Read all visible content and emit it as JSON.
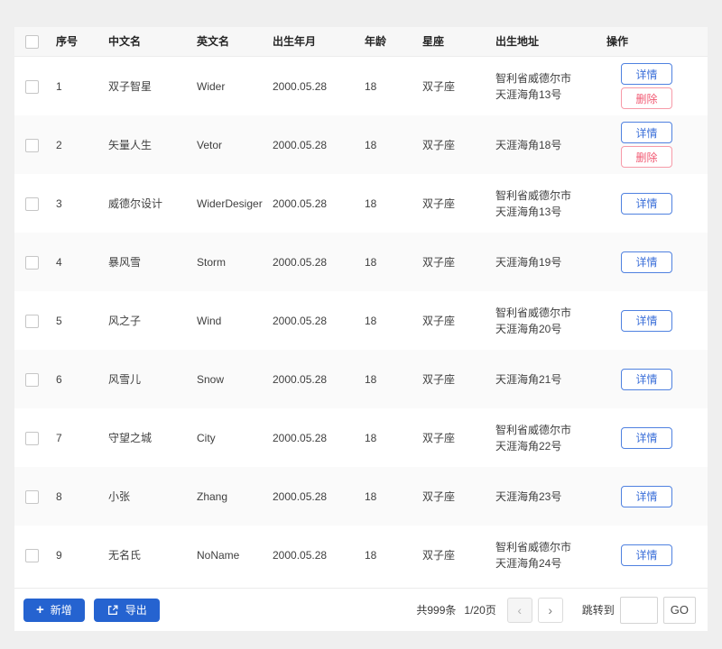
{
  "colors": {
    "accent_blue": "#2563d0",
    "detail_blue": "#3b6fd9",
    "delete_red": "#f15a73",
    "header_bg": "#f7f7f7",
    "stripe_bg": "#fafafa",
    "outer_bg": "#efefef"
  },
  "table": {
    "columns": [
      {
        "key": "index",
        "label": "序号"
      },
      {
        "key": "cn",
        "label": "中文名"
      },
      {
        "key": "en",
        "label": "英文名"
      },
      {
        "key": "birth",
        "label": "出生年月"
      },
      {
        "key": "age",
        "label": "年龄"
      },
      {
        "key": "zodiac",
        "label": "星座"
      },
      {
        "key": "address",
        "label": "出生地址"
      },
      {
        "key": "actions",
        "label": "操作"
      }
    ],
    "action_labels": {
      "detail": "详情",
      "delete": "删除"
    },
    "rows": [
      {
        "index": "1",
        "cn": "双子智星",
        "en": "Wider",
        "birth": "2000.05.28",
        "age": "18",
        "zodiac": "双子座",
        "address": "智利省威德尔市\n天涯海角13号",
        "actions": [
          "detail",
          "delete"
        ]
      },
      {
        "index": "2",
        "cn": "矢量人生",
        "en": "Vetor",
        "birth": "2000.05.28",
        "age": "18",
        "zodiac": "双子座",
        "address": "天涯海角18号",
        "actions": [
          "detail",
          "delete"
        ]
      },
      {
        "index": "3",
        "cn": "威德尔设计",
        "en": "WiderDesiger",
        "birth": "2000.05.28",
        "age": "18",
        "zodiac": "双子座",
        "address": "智利省威德尔市\n天涯海角13号",
        "actions": [
          "detail"
        ]
      },
      {
        "index": "4",
        "cn": "暴风雪",
        "en": "Storm",
        "birth": "2000.05.28",
        "age": "18",
        "zodiac": "双子座",
        "address": "天涯海角19号",
        "actions": [
          "detail"
        ]
      },
      {
        "index": "5",
        "cn": "风之子",
        "en": "Wind",
        "birth": "2000.05.28",
        "age": "18",
        "zodiac": "双子座",
        "address": "智利省威德尔市\n天涯海角20号",
        "actions": [
          "detail"
        ]
      },
      {
        "index": "6",
        "cn": "风雪儿",
        "en": "Snow",
        "birth": "2000.05.28",
        "age": "18",
        "zodiac": "双子座",
        "address": "天涯海角21号",
        "actions": [
          "detail"
        ]
      },
      {
        "index": "7",
        "cn": "守望之城",
        "en": "City",
        "birth": "2000.05.28",
        "age": "18",
        "zodiac": "双子座",
        "address": "智利省威德尔市\n天涯海角22号",
        "actions": [
          "detail"
        ]
      },
      {
        "index": "8",
        "cn": "小张",
        "en": "Zhang",
        "birth": "2000.05.28",
        "age": "18",
        "zodiac": "双子座",
        "address": "天涯海角23号",
        "actions": [
          "detail"
        ]
      },
      {
        "index": "9",
        "cn": "无名氏",
        "en": "NoName",
        "birth": "2000.05.28",
        "age": "18",
        "zodiac": "双子座",
        "address": "智利省威德尔市\n天涯海角24号",
        "actions": [
          "detail"
        ]
      }
    ]
  },
  "footer": {
    "add_label": "新增",
    "export_label": "导出",
    "total_text": "共999条",
    "page_text": "1/20页",
    "prev_icon": "‹",
    "next_icon": "›",
    "jump_label": "跳转到",
    "jump_value": "",
    "go_label": "GO"
  }
}
